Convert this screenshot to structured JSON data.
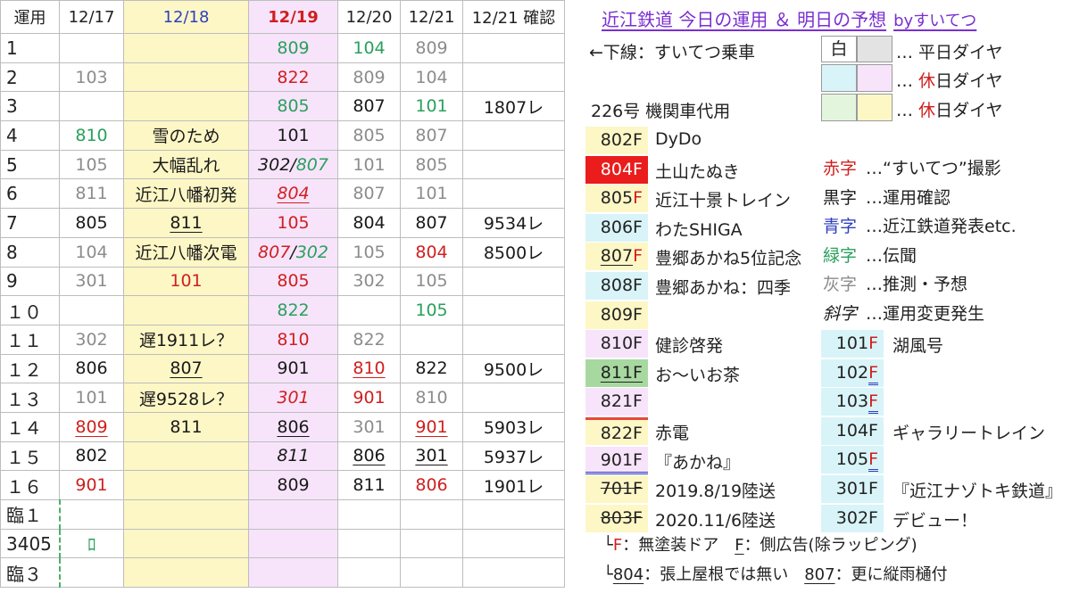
{
  "header": [
    "運用",
    "12/17",
    "12/18",
    "12/19",
    "12/20",
    "12/21",
    "12/21 確認"
  ],
  "rows": [
    {
      "op": "1",
      "c1": "",
      "c2": "",
      "c3": "809",
      "c4": "104",
      "c5": "809",
      "c6": ""
    },
    {
      "op": "2",
      "c1": "103",
      "c2": "",
      "c3": "822",
      "c4": "809",
      "c5": "104",
      "c6": ""
    },
    {
      "op": "3",
      "c1": "",
      "c2": "",
      "c3": "805",
      "c4": "807",
      "c5": "101",
      "c6": "1807レ"
    },
    {
      "op": "4",
      "c1": "810",
      "c2": "雪のため",
      "c3": "101",
      "c4": "805",
      "c5": "807",
      "c6": ""
    },
    {
      "op": "5",
      "c1": "105",
      "c2": "大幅乱れ",
      "c3a": "302",
      "c3sep": "/",
      "c3b": "807",
      "c4": "101",
      "c5": "805",
      "c6": ""
    },
    {
      "op": "6",
      "c1": "811",
      "c2": "近江八幡初発",
      "c3": "804",
      "c4": "807",
      "c5": "101",
      "c6": ""
    },
    {
      "op": "7",
      "c1": "805",
      "c2": "811",
      "c3": "105",
      "c4": "804",
      "c5": "807",
      "c6": "9534レ"
    },
    {
      "op": "8",
      "c1": "104",
      "c2": "近江八幡次電",
      "c3a": "807",
      "c3sep": "/",
      "c3b": "302",
      "c4": "105",
      "c5": "804",
      "c6": "8500レ"
    },
    {
      "op": "9",
      "c1": "301",
      "c2": "101",
      "c3": "805",
      "c4": "302",
      "c5": "105",
      "c6": ""
    },
    {
      "op": "１０",
      "c1": "",
      "c2": "",
      "c3": "822",
      "c4": "",
      "c5": "105",
      "c6": ""
    },
    {
      "op": "１１",
      "c1": "302",
      "c2": "遅1911レ？",
      "c3": "810",
      "c4": "822",
      "c5": "",
      "c6": ""
    },
    {
      "op": "１２",
      "c1": "806",
      "c2": "807",
      "c3": "901",
      "c4": "810",
      "c5": "822",
      "c6": "9500レ"
    },
    {
      "op": "１３",
      "c1": "101",
      "c2": "遅9528レ？",
      "c3": "301",
      "c4": "901",
      "c5": "810",
      "c6": ""
    },
    {
      "op": "１４",
      "c1": "809",
      "c2": "811",
      "c3": "806",
      "c4": "301",
      "c5": "901",
      "c6": "5903レ"
    },
    {
      "op": "１５",
      "c1": "802",
      "c2": "",
      "c3": "811",
      "c4": "806",
      "c5": "301",
      "c6": "5937レ"
    },
    {
      "op": "１６",
      "c1": "901",
      "c2": "",
      "c3": "809",
      "c4": "811",
      "c5": "806",
      "c6": "1901レ"
    },
    {
      "op": "臨１",
      "c1": "",
      "c2": "",
      "c3": "",
      "c4": "",
      "c5": "",
      "c6": ""
    },
    {
      "op": "3405",
      "c1": "ﾛ",
      "c2": "",
      "c3": "",
      "c4": "",
      "c5": "",
      "c6": ""
    },
    {
      "op": "臨３",
      "c1": "",
      "c2": "",
      "c3": "",
      "c4": "",
      "c5": "",
      "c6": ""
    }
  ],
  "right": {
    "title": "近江鉄道 今日の運用 ＆ 明日の予想",
    "by": "byすいてつ",
    "underline_note": "←下線：すいてつ乗車",
    "legend_white": "白",
    "legend_weekday": "… 平日ダイヤ",
    "legend_holiday_dots": "… ",
    "legend_holiday_red": "休",
    "legend_holiday_rest": "日ダイヤ",
    "note_226": "226号 機関車代用",
    "cars": [
      {
        "id": "802F",
        "desc": "DyDo"
      },
      {
        "id": "804F",
        "desc": "土山たぬき"
      },
      {
        "id": "805",
        "f": "F",
        "desc": "近江十景トレイン"
      },
      {
        "id": "806F",
        "desc": "わたSHIGA"
      },
      {
        "id": "807",
        "f": "F",
        "desc": "豊郷あかね5位記念"
      },
      {
        "id": "808F",
        "desc": "豊郷あかね：四季"
      },
      {
        "id": "809F",
        "desc": ""
      },
      {
        "id": "810F",
        "desc": "健診啓発"
      },
      {
        "id": "811F",
        "desc": "お～いお茶"
      },
      {
        "id": "821F",
        "desc": ""
      },
      {
        "id": "822F",
        "desc": "赤電"
      },
      {
        "id": "901F",
        "desc": "『あかね』"
      },
      {
        "id": "701F",
        "desc": "2019.8/19陸送"
      },
      {
        "id": "803F",
        "desc": "2020.11/6陸送"
      }
    ],
    "color_legend": [
      {
        "word": "赤字",
        "desc": "…“すいてつ”撮影"
      },
      {
        "word": "黒字",
        "desc": "…運用確認"
      },
      {
        "word": "青字",
        "desc": "…近江鉄道発表etc."
      },
      {
        "word": "緑字",
        "desc": "…伝聞"
      },
      {
        "word": "灰字",
        "desc": "…推測・予想"
      },
      {
        "word": "斜字",
        "desc": "…運用変更発生"
      }
    ],
    "cars2": [
      {
        "id": "101",
        "f": "F",
        "desc": "湖風号"
      },
      {
        "id": "102",
        "f": "F",
        "desc": ""
      },
      {
        "id": "103",
        "f": "F",
        "desc": ""
      },
      {
        "id": "104F",
        "desc": "ギャラリートレイン"
      },
      {
        "id": "105",
        "f": "F",
        "desc": ""
      },
      {
        "id": "301F",
        "desc": "『近江ナゾトキ鉄道』"
      },
      {
        "id": "302F",
        "desc": "デビュー！"
      }
    ],
    "foot1_a": "└",
    "foot1_f": "F",
    "foot1_b": "：無塗装ドア",
    "foot1_c": "F",
    "foot1_d": "：側広告(除ラッピング)",
    "foot2_a": "└",
    "foot2_n1": "804",
    "foot2_b": "：張上屋根では無い",
    "foot2_n2": "807",
    "foot2_c": "：更に縦雨樋付"
  }
}
